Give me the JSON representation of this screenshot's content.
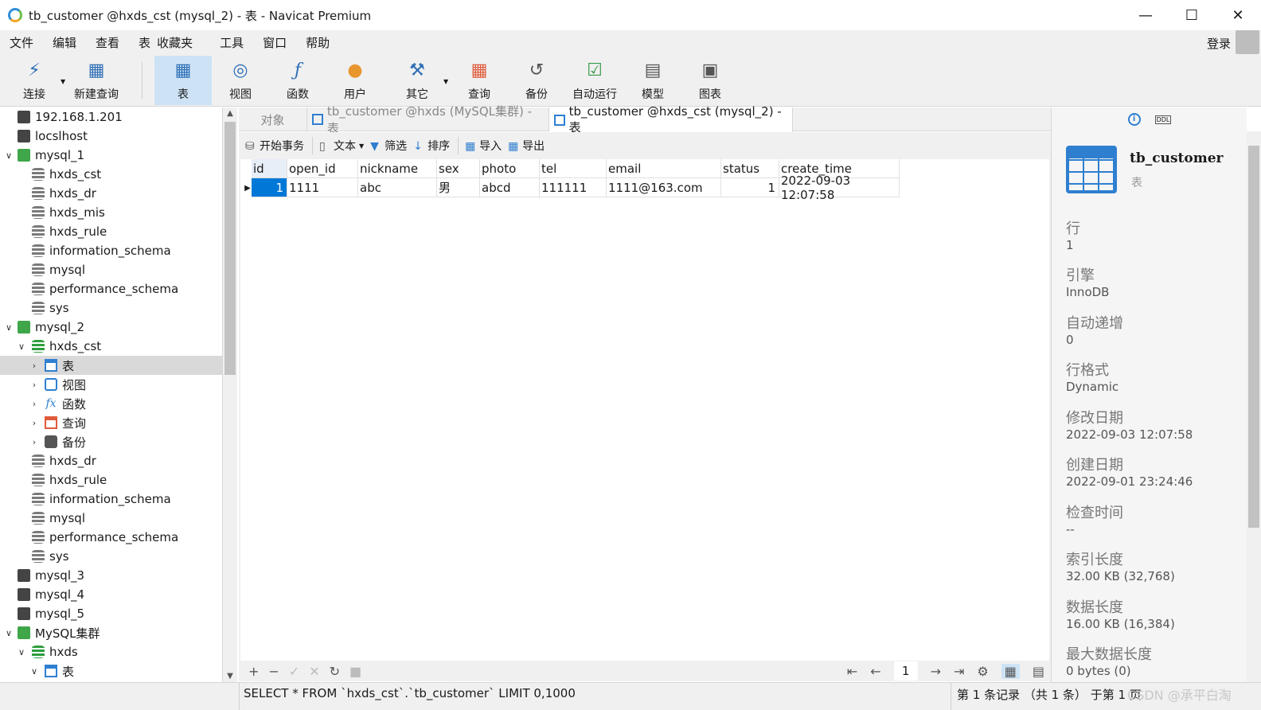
{
  "window": {
    "title": "tb_customer @hxds_cst (mysql_2) - 表 - Navicat Premium",
    "minimize": "—",
    "maximize": "☐",
    "close": "✕"
  },
  "menu": {
    "items": [
      "文件",
      "编辑",
      "查看",
      "表",
      "收藏夹",
      "工具",
      "窗口",
      "帮助"
    ],
    "login": "登录"
  },
  "toolbar": {
    "buttons": [
      {
        "label": "连接",
        "icon": "plug-icon"
      },
      {
        "label": "新建查询",
        "icon": "new-query-icon"
      },
      {
        "label": "表",
        "icon": "table-icon"
      },
      {
        "label": "视图",
        "icon": "view-icon"
      },
      {
        "label": "函数",
        "icon": "function-icon"
      },
      {
        "label": "用户",
        "icon": "user-icon"
      },
      {
        "label": "其它",
        "icon": "tools-icon"
      },
      {
        "label": "查询",
        "icon": "query-icon"
      },
      {
        "label": "备份",
        "icon": "backup-icon"
      },
      {
        "label": "自动运行",
        "icon": "schedule-icon"
      },
      {
        "label": "模型",
        "icon": "model-icon"
      },
      {
        "label": "图表",
        "icon": "chart-icon"
      }
    ]
  },
  "tree": {
    "nodes": [
      {
        "label": "192.168.1.201",
        "icon": "conn-gray"
      },
      {
        "label": "locslhost",
        "icon": "conn-gray"
      },
      {
        "label": "mysql_1",
        "icon": "conn-green"
      },
      {
        "label": "hxds_cst",
        "icon": "db-gray"
      },
      {
        "label": "hxds_dr",
        "icon": "db-gray"
      },
      {
        "label": "hxds_mis",
        "icon": "db-gray"
      },
      {
        "label": "hxds_rule",
        "icon": "db-gray"
      },
      {
        "label": "information_schema",
        "icon": "db-gray"
      },
      {
        "label": "mysql",
        "icon": "db-gray"
      },
      {
        "label": "performance_schema",
        "icon": "db-gray"
      },
      {
        "label": "sys",
        "icon": "db-gray"
      },
      {
        "label": "mysql_2",
        "icon": "conn-green"
      },
      {
        "label": "hxds_cst",
        "icon": "db-green"
      },
      {
        "label": "表",
        "icon": "table"
      },
      {
        "label": "视图",
        "icon": "view"
      },
      {
        "label": "函数",
        "icon": "func"
      },
      {
        "label": "查询",
        "icon": "query"
      },
      {
        "label": "备份",
        "icon": "backup"
      },
      {
        "label": "hxds_dr",
        "icon": "db-gray"
      },
      {
        "label": "hxds_rule",
        "icon": "db-gray"
      },
      {
        "label": "information_schema",
        "icon": "db-gray"
      },
      {
        "label": "mysql",
        "icon": "db-gray"
      },
      {
        "label": "performance_schema",
        "icon": "db-gray"
      },
      {
        "label": "sys",
        "icon": "db-gray"
      },
      {
        "label": "mysql_3",
        "icon": "conn-gray"
      },
      {
        "label": "mysql_4",
        "icon": "conn-gray"
      },
      {
        "label": "mysql_5",
        "icon": "conn-gray"
      },
      {
        "label": "MySQL集群",
        "icon": "conn-green"
      },
      {
        "label": "hxds",
        "icon": "db-green"
      },
      {
        "label": "表",
        "icon": "table"
      }
    ]
  },
  "tabs": {
    "objects": "对象",
    "tab1": "tb_customer @hxds (MySQL集群) - 表",
    "tab2": "tb_customer @hxds_cst (mysql_2) - 表"
  },
  "objbar": {
    "begin_tx": "开始事务",
    "text": "文本",
    "filter": "筛选",
    "sort": "排序",
    "import": "导入",
    "export": "导出"
  },
  "grid": {
    "columns": [
      "id",
      "open_id",
      "nickname",
      "sex",
      "photo",
      "tel",
      "email",
      "status",
      "create_time"
    ],
    "rows": [
      [
        "1",
        "1111",
        "abc",
        "男",
        "abcd",
        "111111",
        "1111@163.com",
        "1",
        "2022-09-03 12:07:58"
      ]
    ],
    "page": "1"
  },
  "info": {
    "name": "tb_customer",
    "type": "表",
    "props": [
      {
        "label": "行",
        "value": "1"
      },
      {
        "label": "引擎",
        "value": "InnoDB"
      },
      {
        "label": "自动递增",
        "value": "0"
      },
      {
        "label": "行格式",
        "value": "Dynamic"
      },
      {
        "label": "修改日期",
        "value": "2022-09-03 12:07:58"
      },
      {
        "label": "创建日期",
        "value": "2022-09-01 23:24:46"
      },
      {
        "label": "检查时间",
        "value": "--"
      },
      {
        "label": "索引长度",
        "value": "32.00 KB (32,768)"
      },
      {
        "label": "数据长度",
        "value": "16.00 KB (16,384)"
      },
      {
        "label": "最大数据长度",
        "value": "0 bytes (0)"
      }
    ]
  },
  "status": {
    "sql": "SELECT * FROM `hxds_cst`.`tb_customer` LIMIT 0,1000",
    "records": "第 1 条记录 （共 1 条） 于第 1 页",
    "watermark": "CSDN @承平白淘"
  }
}
